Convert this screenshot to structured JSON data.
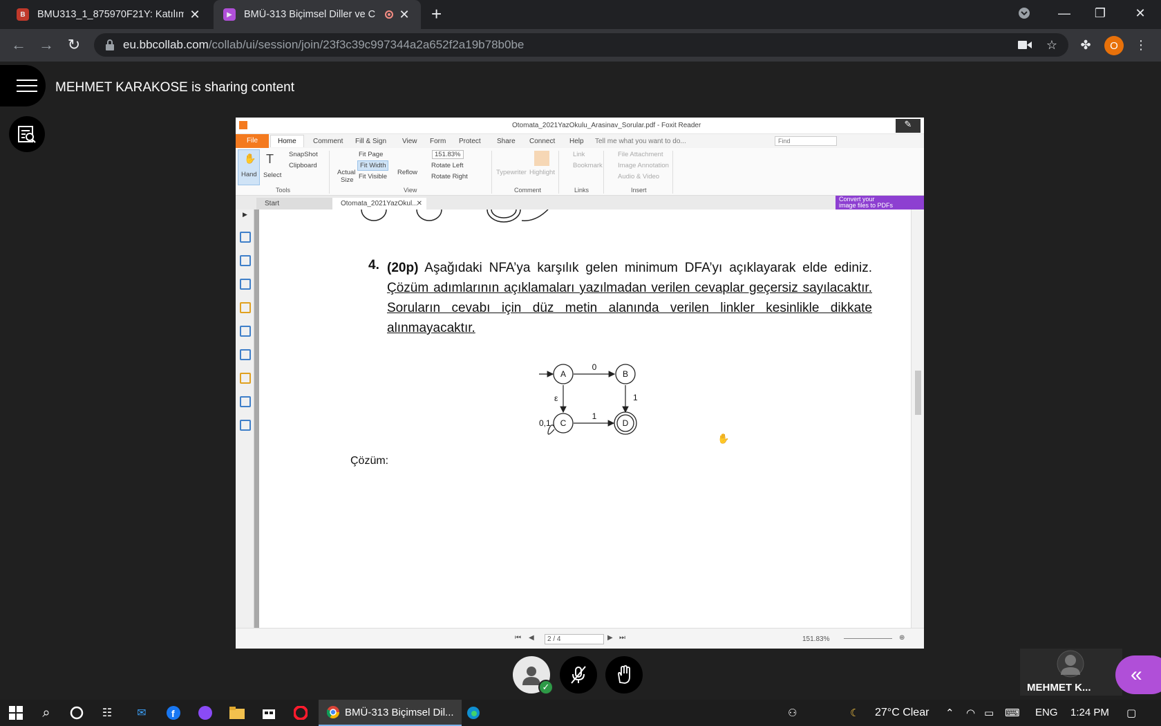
{
  "browser": {
    "tabs": [
      {
        "title": "BMU313_1_875970F21Y: Katılımc",
        "icon": "blackboard-icon",
        "icon_color": "#c0392b"
      },
      {
        "title": "BMÜ-313 Biçimsel Diller ve C",
        "icon": "collab-icon",
        "icon_color": "#b04fd8",
        "active": true
      }
    ],
    "url_host": "eu.bbcollab.com",
    "url_path": "/collab/ui/session/join/23f3c39c997344a2a652f2a19b78b0be",
    "profile_initial": "O"
  },
  "collab": {
    "sharing_text": "MEHMET KARAKOSE is sharing content",
    "participant_name": "MEHMET K...",
    "accent_color": "#b04fd8"
  },
  "foxit": {
    "window_title": "Otomata_2021YazOkulu_Arasinav_Sorular.pdf - Foxit Reader",
    "menu": [
      "File",
      "Home",
      "Comment",
      "Fill & Sign",
      "View",
      "Form",
      "Protect",
      "Share",
      "Connect",
      "Help"
    ],
    "tell_me": "Tell me what you want to do...",
    "find_placeholder": "Find",
    "ribbon": {
      "hand": "Hand",
      "select": "Select",
      "snapshot": "SnapShot",
      "clipboard": "Clipboard",
      "actual_size_1": "Actual",
      "actual_size_2": "Size",
      "fit_page": "Fit Page",
      "fit_width": "Fit Width",
      "fit_visible": "Fit Visible",
      "reflow": "Reflow",
      "zoom": "151.83%",
      "rotate_left": "Rotate Left",
      "rotate_right": "Rotate Right",
      "typewriter": "Typewriter",
      "highlight": "Highlight",
      "link": "Link",
      "bookmark": "Bookmark",
      "file_attachment": "File Attachment",
      "image_annotation": "Image Annotation",
      "audio_video": "Audio & Video",
      "groups": [
        "Tools",
        "View",
        "Comment",
        "Links",
        "Insert"
      ]
    },
    "doc_tabs": [
      "Start",
      "Otomata_2021YazOkul..."
    ],
    "convert_promo": [
      "Convert your",
      "image files to PDFs"
    ],
    "page_indicator": "2 / 4",
    "zoom_status": "151.83%"
  },
  "document": {
    "question_number": "4.",
    "points": "(20p)",
    "question_text": " Aşağıdaki NFA’ya karşılık gelen minimum DFA’yı açıklayarak elde ediniz. ",
    "emphasis_text": "Çözüm adımlarının açıklamaları yazılmadan verilen cevaplar geçersiz sayılacaktır. Soruların cevabı için düz metin alanında verilen linkler kesinlikle dikkate alınmayacaktır.",
    "nfa": {
      "states": [
        "A",
        "B",
        "C",
        "D"
      ],
      "labels": {
        "a_b": "0",
        "b_d": "1",
        "a_c": "ε",
        "c_d": "1",
        "c_loop": "0,1"
      }
    },
    "solution_label": "Çözüm:"
  },
  "taskbar": {
    "active_app": "BMÜ-313 Biçimsel Dil...",
    "weather": "27°C  Clear",
    "language": "ENG",
    "time": "1:24 PM"
  }
}
